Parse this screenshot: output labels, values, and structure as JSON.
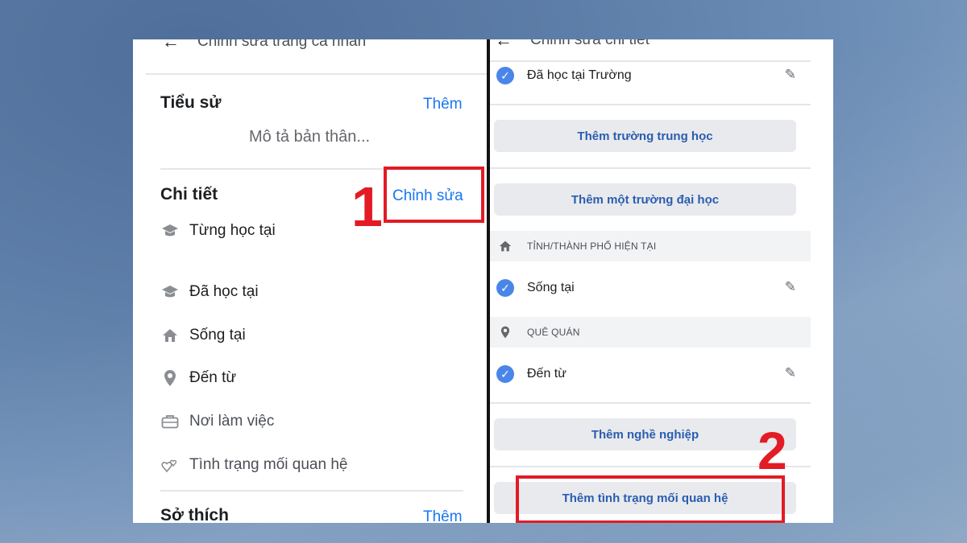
{
  "left": {
    "header_title": "Chỉnh sửa trang cá nhân",
    "bio": {
      "title": "Tiểu sử",
      "action": "Thêm",
      "placeholder": "Mô tả bản thân..."
    },
    "details": {
      "title": "Chi tiết",
      "action": "Chỉnh sửa",
      "step": "1",
      "items": [
        {
          "icon": "graduation-cap-icon",
          "label": "Từng học tại"
        },
        {
          "icon": "graduation-cap-icon",
          "label": "Đã học tại"
        },
        {
          "icon": "home-icon",
          "label": "Sống tại"
        },
        {
          "icon": "location-pin-icon",
          "label": "Đến từ"
        },
        {
          "icon": "briefcase-icon",
          "label": "Nơi làm việc"
        },
        {
          "icon": "hearts-icon",
          "label": "Tình trạng mối quan hệ"
        }
      ]
    },
    "hobbies": {
      "title": "Sở thích",
      "action": "Thêm"
    }
  },
  "right": {
    "header_title": "Chỉnh sửa chi tiết",
    "rows": [
      {
        "label": "Đã học tại Trường"
      },
      {
        "label": "Sống tại"
      },
      {
        "label": "Đến từ"
      }
    ],
    "buttons": {
      "high_school": "Thêm trường trung học",
      "university": "Thêm một trường đại học",
      "work": "Thêm nghề nghiệp",
      "relationship": "Thêm tình trạng mối quan hệ"
    },
    "sections": {
      "current_city": "TỈNH/THÀNH PHỐ HIỆN TẠI",
      "hometown": "QUÊ QUÁN"
    },
    "step": "2"
  },
  "colors": {
    "accent": "#1877f2",
    "highlight": "#e21b25",
    "check": "#4a86e8"
  }
}
